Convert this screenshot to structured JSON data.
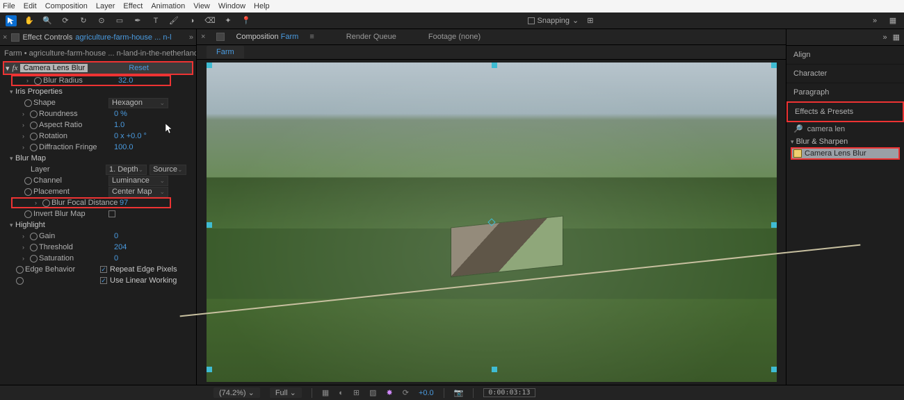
{
  "menu": [
    "File",
    "Edit",
    "Composition",
    "Layer",
    "Effect",
    "Animation",
    "View",
    "Window",
    "Help"
  ],
  "snapping_label": "Snapping",
  "effect_controls": {
    "panel_title": "Effect Controls",
    "asset_name": "agriculture-farm-house ... n-l",
    "breadcrumb": "Farm • agriculture-farm-house ... n-land-in-the-netherlands-farm",
    "effect_name": "Camera Lens Blur",
    "reset_label": "Reset",
    "blur_radius": {
      "label": "Blur Radius",
      "value": "32.0"
    },
    "iris": {
      "header": "Iris Properties",
      "shape": {
        "label": "Shape",
        "value": "Hexagon"
      },
      "roundness": {
        "label": "Roundness",
        "value": "0 %"
      },
      "aspect_ratio": {
        "label": "Aspect Ratio",
        "value": "1.0"
      },
      "rotation": {
        "label": "Rotation",
        "value": "0 x +0.0 °"
      },
      "diffraction": {
        "label": "Diffraction Fringe",
        "value": "100.0"
      }
    },
    "blur_map": {
      "header": "Blur Map",
      "layer": {
        "label": "Layer",
        "value": "1. Depth",
        "source": "Source"
      },
      "channel": {
        "label": "Channel",
        "value": "Luminance"
      },
      "placement": {
        "label": "Placement",
        "value": "Center Map"
      },
      "focal": {
        "label": "Blur Focal Distance",
        "value": "97"
      },
      "invert": {
        "label": "Invert Blur Map"
      }
    },
    "highlight": {
      "header": "Highlight",
      "gain": {
        "label": "Gain",
        "value": "0"
      },
      "threshold": {
        "label": "Threshold",
        "value": "204"
      },
      "saturation": {
        "label": "Saturation",
        "value": "0"
      }
    },
    "edge_behavior": {
      "label": "Edge Behavior",
      "repeat": "Repeat Edge Pixels",
      "linear": "Use Linear Working"
    }
  },
  "composition": {
    "panel_title": "Composition",
    "comp_name": "Farm",
    "render_queue": "Render Queue",
    "footage": "Footage (none)",
    "tab": "Farm"
  },
  "right": {
    "align": "Align",
    "character": "Character",
    "paragraph": "Paragraph",
    "effects_presets": "Effects & Presets",
    "search_value": "camera len",
    "category": "Blur & Sharpen",
    "preset": "Camera Lens Blur"
  },
  "status": {
    "zoom": "(74.2%)",
    "res": "Full",
    "exposure": "+0.0",
    "timecode": "0:00:03:13"
  }
}
